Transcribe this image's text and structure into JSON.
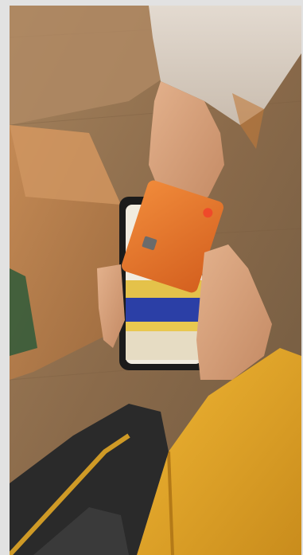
{
  "photo": {
    "subject": "photo",
    "colors": {
      "frame": "#e2e2e2",
      "floor": "#8a6a4a",
      "box": "#b47a4a",
      "sweater": "#d9cfc4",
      "skin": "#d6a17a",
      "card": "#e5742a",
      "phone": "#1b1b1b",
      "screen_blue": "#2b3fa6",
      "screen_yellow": "#e4c24a",
      "jacket": "#e1a626",
      "bag": "#2a2a2a"
    }
  }
}
